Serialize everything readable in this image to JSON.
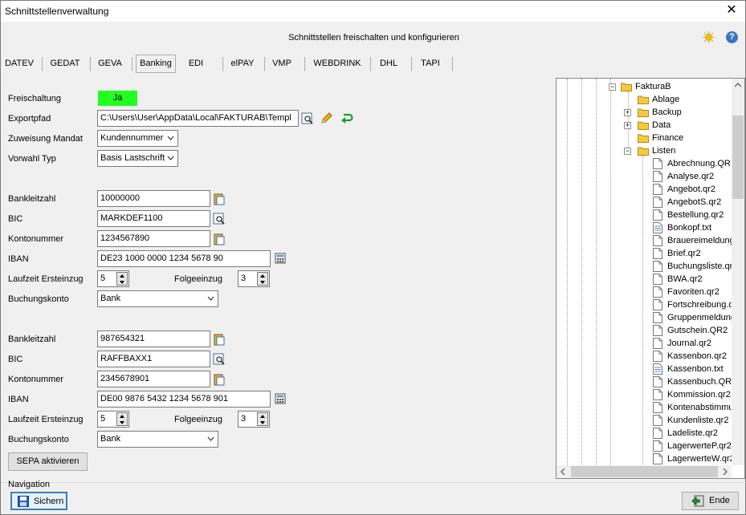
{
  "window": {
    "title": "Schnittstellenverwaltung",
    "close_glyph": "✕"
  },
  "header": {
    "title": "Schnittstellen freischalten und konfigurieren",
    "help_glyph": "?"
  },
  "tabs": [
    "DATEV",
    "GEDAT",
    "GEVA",
    "Banking",
    "EDI",
    "elPAY",
    "VMP",
    "WEBDRINK",
    "DHL",
    "TAPI"
  ],
  "active_tab": "Banking",
  "form": {
    "freischaltung_label": "Freischaltung",
    "freischaltung_value": "Ja",
    "exportpfad_label": "Exportpfad",
    "exportpfad_value": "C:\\Users\\User\\AppData\\Local\\FAKTURAB\\Templ",
    "zuweisung_label": "Zuweisung Mandat",
    "zuweisung_value": "Kundennummer",
    "vorwahl_label": "Vorwahl Typ",
    "vorwahl_value": "Basis Lastschrift"
  },
  "bank1": {
    "blz_label": "Bankleitzahl",
    "blz": "10000000",
    "bic_label": "BIC",
    "bic": "MARKDEF1100",
    "konto_label": "Kontonummer",
    "konto": "1234567890",
    "iban_label": "IBAN",
    "iban": "DE23 1000 0000 1234 5678 90",
    "laufzeit_label": "Laufzeit Ersteinzug",
    "laufzeit": "5",
    "folge_label": "Folgeeinzug",
    "folge": "3",
    "buchung_label": "Buchungskonto",
    "buchung": "Bank"
  },
  "bank2": {
    "blz_label": "Bankleitzahl",
    "blz": "987654321",
    "bic_label": "BIC",
    "bic": "RAFFBAXX1",
    "konto_label": "Kontonummer",
    "konto": "2345678901",
    "iban_label": "IBAN",
    "iban": "DE00 9876 5432 1234 5678 901",
    "laufzeit_label": "Laufzeit Ersteinzug",
    "laufzeit": "5",
    "folge_label": "Folgeeinzug",
    "folge": "3",
    "buchung_label": "Buchungskonto",
    "buchung": "Bank"
  },
  "sepa_button": "SEPA aktivieren",
  "navigation_label": "Navigation",
  "save_button": "Sichern",
  "end_button": "Ende",
  "tree": {
    "root": "FakturaB",
    "folders": [
      "Ablage",
      "Backup",
      "Data",
      "Finance",
      "Listen"
    ],
    "files": [
      "Abrechnung.QR",
      "Analyse.qr2",
      "Angebot.qr2",
      "AngebotS.qr2",
      "Bestellung.qr2",
      "Bonkopf.txt",
      "Brauereimeldung",
      "Brief.qr2",
      "Buchungsliste.qr",
      "BWA.qr2",
      "Favoriten.qr2",
      "Fortschreibung.q",
      "Gruppenmeldung",
      "Gutschein.QR2",
      "Journal.qr2",
      "Kassenbon.qr2",
      "Kassenbon.txt",
      "Kassenbuch.QR",
      "Kommission.qr2",
      "Kontenabstimmu",
      "Kundenliste.qr2",
      "Ladeliste.qr2",
      "LagerwerteP.qr2",
      "LagerwerteW.qr2"
    ]
  }
}
